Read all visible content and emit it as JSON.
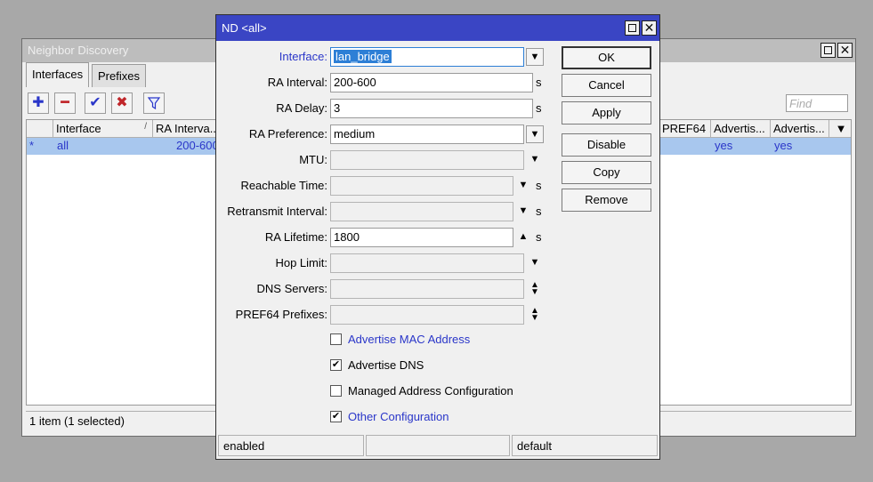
{
  "background_window": {
    "title": "Neighbor Discovery",
    "tabs": [
      "Interfaces",
      "Prefixes"
    ],
    "toolbar": {
      "add_icon": "plus-icon",
      "remove_icon": "minus-icon",
      "enable_icon": "check-icon",
      "disable_icon": "cross-icon",
      "filter_icon": "filter-icon"
    },
    "find_placeholder": "Find",
    "columns": [
      "Interface",
      "RA Interva...",
      "PREF64 ...",
      "Advertis...",
      "Advertis..."
    ],
    "rows": [
      {
        "flag": "*",
        "interface": "all",
        "ra_interval": "200-600",
        "pref64": "",
        "adv_mac": "yes",
        "adv_dns": "yes"
      }
    ],
    "status": "1 item (1 selected)"
  },
  "dialog": {
    "title": "ND <all>",
    "fields": {
      "interface": {
        "label": "Interface:",
        "value": "lan_bridge"
      },
      "ra_interval": {
        "label": "RA Interval:",
        "value": "200-600",
        "unit": "s"
      },
      "ra_delay": {
        "label": "RA Delay:",
        "value": "3",
        "unit": "s"
      },
      "ra_preference": {
        "label": "RA Preference:",
        "value": "medium"
      },
      "mtu": {
        "label": "MTU:",
        "value": ""
      },
      "reachable_time": {
        "label": "Reachable Time:",
        "value": "",
        "unit": "s"
      },
      "retransmit_interval": {
        "label": "Retransmit Interval:",
        "value": "",
        "unit": "s"
      },
      "ra_lifetime": {
        "label": "RA Lifetime:",
        "value": "1800",
        "unit": "s"
      },
      "hop_limit": {
        "label": "Hop Limit:",
        "value": ""
      },
      "dns_servers": {
        "label": "DNS Servers:",
        "value": ""
      },
      "pref64_prefixes": {
        "label": "PREF64 Prefixes:",
        "value": ""
      }
    },
    "checkboxes": {
      "advertise_mac": {
        "label": "Advertise MAC Address",
        "checked": false
      },
      "advertise_dns": {
        "label": "Advertise DNS",
        "checked": true
      },
      "managed_address": {
        "label": "Managed Address Configuration",
        "checked": false
      },
      "other_config": {
        "label": "Other Configuration",
        "checked": true
      }
    },
    "buttons": {
      "ok": "OK",
      "cancel": "Cancel",
      "apply": "Apply",
      "disable": "Disable",
      "copy": "Copy",
      "remove": "Remove"
    },
    "status": [
      "enabled",
      "",
      "default"
    ]
  },
  "colors": {
    "dialog_titlebar": "#3a45c4",
    "selection_row": "#a8c7ee",
    "link_blue": "#2a36c9"
  }
}
